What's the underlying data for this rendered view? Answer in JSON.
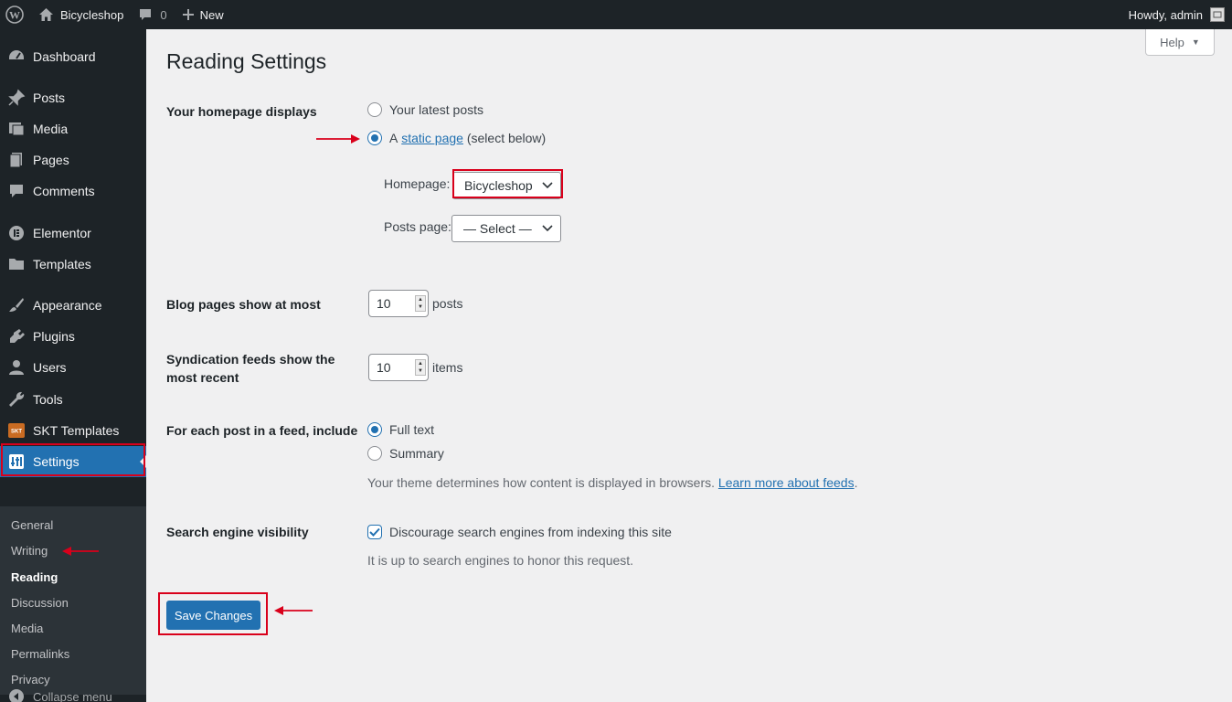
{
  "adminbar": {
    "site_name": "Bicycleshop",
    "comments_count": "0",
    "new_label": "New",
    "greeting": "Howdy, admin"
  },
  "sidebar": {
    "items": [
      {
        "label": "Dashboard",
        "icon": "dashboard-icon"
      },
      {
        "label": "Posts",
        "icon": "pin-icon"
      },
      {
        "label": "Media",
        "icon": "media-icon"
      },
      {
        "label": "Pages",
        "icon": "pages-icon"
      },
      {
        "label": "Comments",
        "icon": "comment-icon"
      },
      {
        "label": "Elementor",
        "icon": "elementor-icon"
      },
      {
        "label": "Templates",
        "icon": "folder-icon"
      },
      {
        "label": "Appearance",
        "icon": "brush-icon"
      },
      {
        "label": "Plugins",
        "icon": "plugin-icon"
      },
      {
        "label": "Users",
        "icon": "user-icon"
      },
      {
        "label": "Tools",
        "icon": "wrench-icon"
      },
      {
        "label": "SKT Templates",
        "icon": "skt-logo-icon"
      },
      {
        "label": "Settings",
        "icon": "settings-icon"
      }
    ],
    "submenu": [
      "General",
      "Writing",
      "Reading",
      "Discussion",
      "Media",
      "Permalinks",
      "Privacy"
    ],
    "collapse_label": "Collapse menu"
  },
  "help_label": "Help",
  "page_title": "Reading Settings",
  "homepage_displays": {
    "label": "Your homepage displays",
    "option_latest": "Your latest posts",
    "option_static_prefix": "A",
    "option_static_link": "static page",
    "option_static_suffix": "(select below)",
    "selected": "static",
    "homepage_label": "Homepage:",
    "homepage_value": "Bicycleshop",
    "posts_page_label": "Posts page:",
    "posts_page_value": "— Select —"
  },
  "blog_pages": {
    "label": "Blog pages show at most",
    "value": "10",
    "unit": "posts"
  },
  "syndication": {
    "label_line1": "Syndication feeds show the",
    "label_line2": "most recent",
    "value": "10",
    "unit": "items"
  },
  "feed_include": {
    "label": "For each post in a feed, include",
    "option_full": "Full text",
    "option_summary": "Summary",
    "selected": "full",
    "desc_prefix": "Your theme determines how content is displayed in browsers.",
    "desc_link": "Learn more about feeds",
    "desc_suffix": "."
  },
  "search_visibility": {
    "label": "Search engine visibility",
    "checkbox_label": "Discourage search engines from indexing this site",
    "checked": true,
    "desc": "It is up to search engines to honor this request."
  },
  "save_label": "Save Changes",
  "colors": {
    "accent": "#2271b1",
    "annotation": "#d9001b",
    "sidebar": "#1d2327"
  }
}
